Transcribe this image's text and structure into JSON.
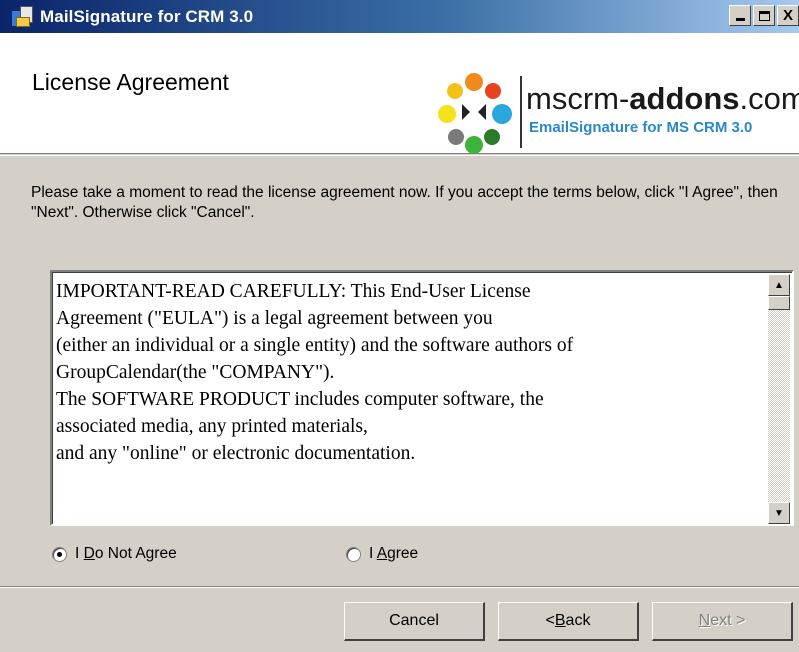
{
  "window": {
    "title": "MailSignature for CRM 3.0",
    "caption_buttons": [
      "minimize-icon",
      "maximize-icon",
      "close-icon"
    ],
    "close_glyph": "X"
  },
  "header": {
    "title": "License Agreement",
    "logo": {
      "brand_prefix": "mscrm-",
      "brand_bold": "addons",
      "brand_suffix": ".com",
      "subtitle": "EmailSignature for MS CRM 3.0"
    }
  },
  "description": "Please take a moment to read the license agreement now. If you accept the terms below, click \"I Agree\", then \"Next\". Otherwise click \"Cancel\".",
  "license": {
    "lines": [
      "IMPORTANT-READ CAREFULLY: This End-User License",
      "Agreement (\"EULA\") is a legal agreement between you",
      "(either an individual or a single entity) and the software authors of",
      "GroupCalendar(the \"COMPANY\").",
      "The SOFTWARE PRODUCT includes computer software, the",
      "associated media, any printed materials,",
      "and any \"online\" or electronic documentation."
    ]
  },
  "radios": {
    "do_not_agree": {
      "label_pre": "I ",
      "label_accel": "D",
      "label_post": "o Not Agree",
      "checked": true
    },
    "agree": {
      "label_pre": "I ",
      "label_accel": "A",
      "label_post": "gree",
      "checked": false
    }
  },
  "buttons": {
    "cancel": "Cancel",
    "back_pre": "< ",
    "back_accel": "B",
    "back_post": "ack",
    "next_accel": "N",
    "next_post": "ext >"
  },
  "colors": {
    "titlebar_start": "#0a246a",
    "titlebar_end": "#a6caf0",
    "dialog_face": "#d4d0c8",
    "logo_subtitle": "#2b88c7"
  }
}
